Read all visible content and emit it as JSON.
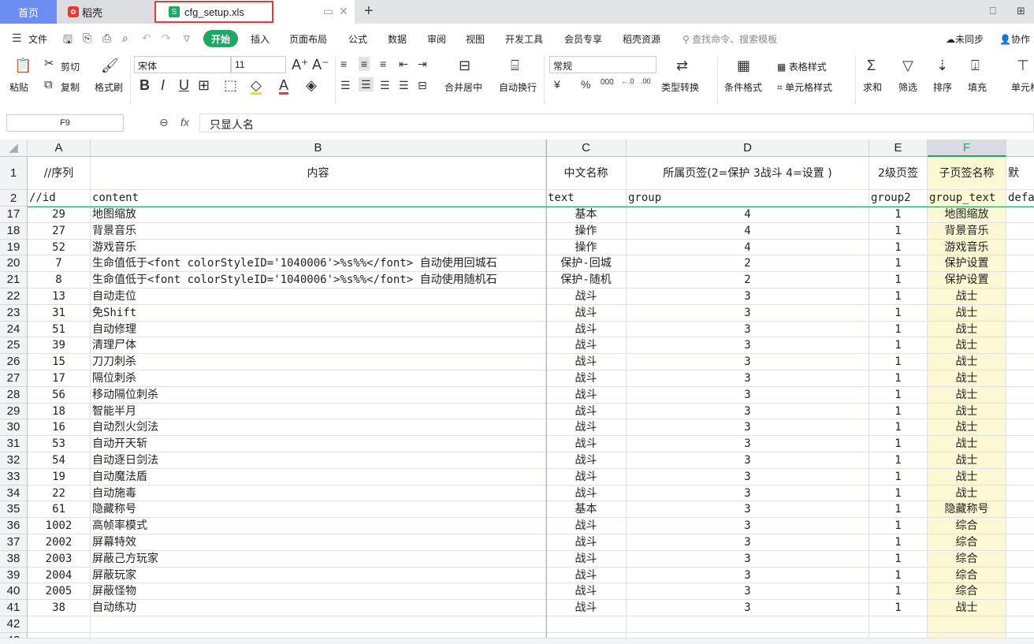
{
  "tabs": {
    "home": "首页",
    "daoke": "稻壳",
    "file": "cfg_setup.xls"
  },
  "menu": {
    "file": "文件",
    "items": [
      "开始",
      "插入",
      "页面布局",
      "公式",
      "数据",
      "审阅",
      "视图",
      "开发工具",
      "会员专享",
      "稻壳资源"
    ],
    "search_placeholder": "查找命令、搜索模板",
    "sync": "未同步",
    "collab": "协作"
  },
  "ribbon": {
    "paste": "粘贴",
    "cut": "剪切",
    "copy": "复制",
    "format_painter": "格式刷",
    "font": "宋体",
    "size": "11",
    "merge": "合并居中",
    "wrap": "自动换行",
    "number_format": "常规",
    "type_convert": "类型转换",
    "cond_format": "条件格式",
    "table_style": "表格样式",
    "cell_style": "单元格样式",
    "sum": "求和",
    "filter": "筛选",
    "sort": "排序",
    "fill": "填充",
    "cell": "单元格"
  },
  "formula": {
    "cell_ref": "F9",
    "value": "只显人名"
  },
  "columns": [
    "A",
    "B",
    "C",
    "D",
    "E",
    "F"
  ],
  "row1": [
    "//序列",
    "内容",
    "中文名称",
    "所属页签(2=保护 3战斗 4=设置 )",
    "2级页签",
    "子页签名称",
    "默"
  ],
  "row2": [
    "//id",
    "content",
    "text",
    "group",
    "group2",
    "group_text",
    "defa"
  ],
  "rows": [
    [
      "17",
      "29",
      "地图缩放",
      "基本",
      "4",
      "1",
      "地图缩放"
    ],
    [
      "18",
      "27",
      "背景音乐",
      "操作",
      "4",
      "1",
      "背景音乐"
    ],
    [
      "19",
      "52",
      "游戏音乐",
      "操作",
      "4",
      "1",
      "游戏音乐"
    ],
    [
      "20",
      "7",
      "生命值低于<font colorStyleID='1040006'>%s%%</font> 自动使用回城石",
      "保护-回城",
      "2",
      "1",
      "保护设置"
    ],
    [
      "21",
      "8",
      "生命值低于<font colorStyleID='1040006'>%s%%</font> 自动使用随机石",
      "保护-随机",
      "2",
      "1",
      "保护设置"
    ],
    [
      "22",
      "13",
      "自动走位",
      "战斗",
      "3",
      "1",
      "战士"
    ],
    [
      "23",
      "31",
      "免Shift",
      "战斗",
      "3",
      "1",
      "战士"
    ],
    [
      "24",
      "51",
      "自动修理",
      "战斗",
      "3",
      "1",
      "战士"
    ],
    [
      "25",
      "39",
      "清理尸体",
      "战斗",
      "3",
      "1",
      "战士"
    ],
    [
      "26",
      "15",
      "刀刀刺杀",
      "战斗",
      "3",
      "1",
      "战士"
    ],
    [
      "27",
      "17",
      "隔位刺杀",
      "战斗",
      "3",
      "1",
      "战士"
    ],
    [
      "28",
      "56",
      "移动隔位刺杀",
      "战斗",
      "3",
      "1",
      "战士"
    ],
    [
      "29",
      "18",
      "智能半月",
      "战斗",
      "3",
      "1",
      "战士"
    ],
    [
      "30",
      "16",
      "自动烈火剑法",
      "战斗",
      "3",
      "1",
      "战士"
    ],
    [
      "31",
      "53",
      "自动开天斩",
      "战斗",
      "3",
      "1",
      "战士"
    ],
    [
      "32",
      "54",
      "自动逐日剑法",
      "战斗",
      "3",
      "1",
      "战士"
    ],
    [
      "33",
      "19",
      "自动魔法盾",
      "战斗",
      "3",
      "1",
      "战士"
    ],
    [
      "34",
      "22",
      "自动施毒",
      "战斗",
      "3",
      "1",
      "战士"
    ],
    [
      "35",
      "61",
      "隐藏称号",
      "基本",
      "3",
      "1",
      "隐藏称号"
    ],
    [
      "36",
      "1002",
      "高帧率模式",
      "战斗",
      "3",
      "1",
      "综合"
    ],
    [
      "37",
      "2002",
      "屏幕特效",
      "战斗",
      "3",
      "1",
      "综合"
    ],
    [
      "38",
      "2003",
      "屏蔽己方玩家",
      "战斗",
      "3",
      "1",
      "综合"
    ],
    [
      "39",
      "2004",
      "屏蔽玩家",
      "战斗",
      "3",
      "1",
      "综合"
    ],
    [
      "40",
      "2005",
      "屏蔽怪物",
      "战斗",
      "3",
      "1",
      "综合"
    ],
    [
      "41",
      "38",
      "自动练功",
      "战斗",
      "3",
      "1",
      "战士"
    ]
  ],
  "empty_rows": [
    "42",
    "43"
  ],
  "colors": {
    "accent": "#1fa865",
    "selected_col": "#fbf8d3",
    "home_tab": "#6b8ef0",
    "highlight": "#e53935"
  }
}
